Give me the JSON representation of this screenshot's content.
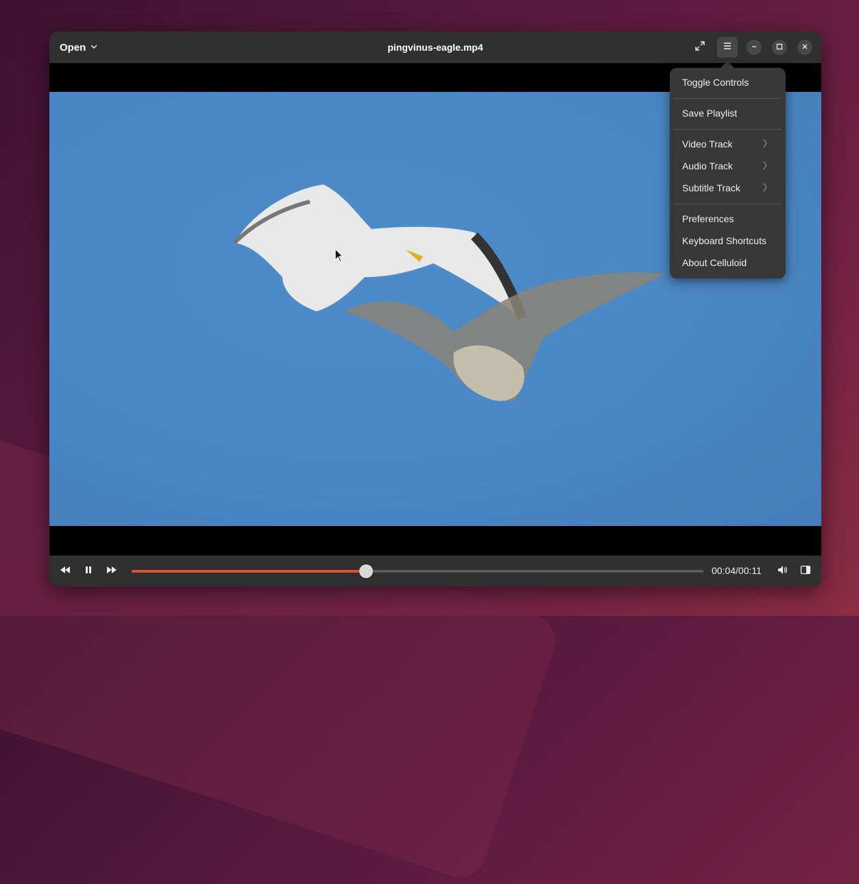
{
  "header": {
    "open_label": "Open",
    "title": "pingvinus-eagle.mp4"
  },
  "menu": {
    "items": [
      {
        "label": "Toggle Controls"
      },
      {
        "label": "Save Playlist"
      },
      {
        "label": "Video Track",
        "submenu": true
      },
      {
        "label": "Audio Track",
        "submenu": true
      },
      {
        "label": "Subtitle Track",
        "submenu": true
      },
      {
        "label": "Preferences"
      },
      {
        "label": "Keyboard Shortcuts"
      },
      {
        "label": "About Celluloid"
      }
    ]
  },
  "controls": {
    "time": "00:04/00:11",
    "progress": 0.41
  },
  "icons": [
    "chevron-down-icon",
    "fullscreen-icon",
    "hamburger-menu-icon",
    "minimize-icon",
    "maximize-icon",
    "close-icon",
    "rewind-icon",
    "pause-icon",
    "forward-icon",
    "volume-icon",
    "sidebar-toggle-icon",
    "mouse-cursor-icon"
  ],
  "colors": {
    "accent": "#e0502c",
    "sky": "#4a86c4"
  }
}
